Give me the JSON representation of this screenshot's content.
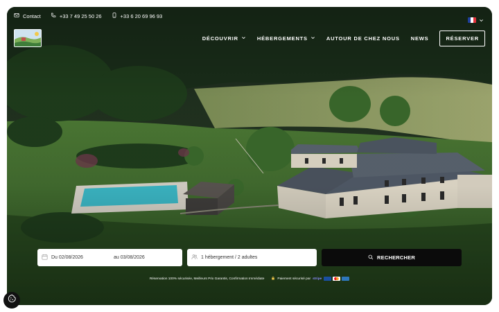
{
  "topbar": {
    "contact_label": "Contact",
    "phone_1": "+33 7 49 25 50 26",
    "phone_2": "+33 6 20 69 96 93",
    "language_flag": "french-flag-icon"
  },
  "nav": {
    "items": [
      {
        "label": "DÉCOUVRIR",
        "has_dropdown": true
      },
      {
        "label": "HÉBERGEMENTS",
        "has_dropdown": true
      },
      {
        "label": "AUTOUR DE CHEZ NOUS",
        "has_dropdown": false
      },
      {
        "label": "NEWS",
        "has_dropdown": false
      }
    ],
    "reserve_label": "RÉSERVER"
  },
  "search": {
    "date_from": "Du 02/08/2026",
    "date_to": "au 03/08/2026",
    "guests": "1 hébergement / 2 adultes",
    "button_label": "RECHERCHER"
  },
  "trust": {
    "guarantee_text": "Réservation 100% sécurisée, Meilleurs Prix Garantis, Confirmation Immédiate",
    "payment_text": "Paiement sécurisé par",
    "payment_brand": "stripe"
  },
  "colors": {
    "search_button": "#0b0b0b",
    "flag_blue": "#1f3f9b",
    "flag_red": "#e0303a"
  }
}
